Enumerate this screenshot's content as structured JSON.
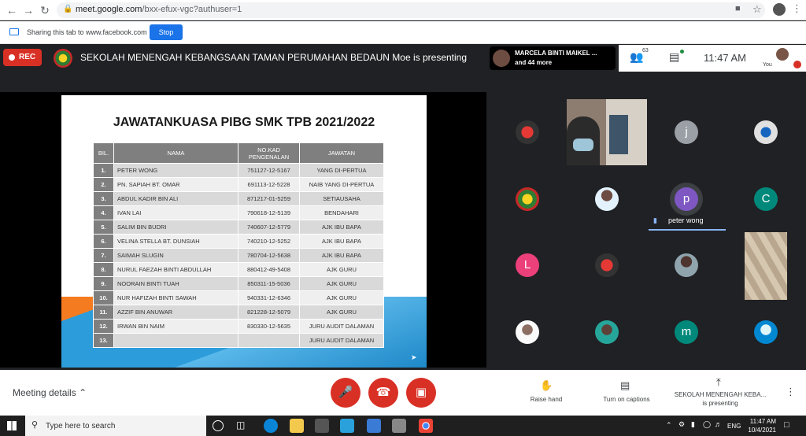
{
  "browser": {
    "url_host": "meet.google.com",
    "url_path": "/bxx-efux-vgc?authuser=1",
    "share_text": "Sharing this tab to www.facebook.com",
    "stop_label": "Stop"
  },
  "topbar": {
    "rec_label": "REC",
    "presenting_text": "SEKOLAH MENENGAH KEBANGSAAN TAMAN PERUMAHAN BEDAUN Moe is presenting",
    "people_name": "MARCELA BINTI MAIKEL ...",
    "people_more": "and 44 more",
    "participant_count": "63",
    "time": "11:47  AM",
    "you_label": "You"
  },
  "slide": {
    "title": "JAWATANKUASA PIBG SMK TPB 2021/2022",
    "headers": [
      "BIL.",
      "NAMA",
      "NO.KAD PENGENALAN",
      "JAWATAN"
    ],
    "rows": [
      {
        "bil": "1.",
        "nama": "PETER WONG",
        "ic": "751127-12-5167",
        "jawatan": "YANG DI-PERTUA"
      },
      {
        "bil": "2.",
        "nama": "PN. SAPIAH BT. OMAR",
        "ic": "691113-12-5228",
        "jawatan": "NAIB YANG DI-PERTUA"
      },
      {
        "bil": "3.",
        "nama": "ABDUL KADIR BIN ALI",
        "ic": "871217-01-5259",
        "jawatan": "SETIAUSAHA"
      },
      {
        "bil": "4.",
        "nama": "IVAN LAI",
        "ic": "790618-12-5139",
        "jawatan": "BENDAHARI"
      },
      {
        "bil": "5.",
        "nama": "SALIM BIN BUDRI",
        "ic": "740607-12-5779",
        "jawatan": "AJK IBU BAPA"
      },
      {
        "bil": "6.",
        "nama": "VELINA STELLA BT. DUNSIAH",
        "ic": "740210-12-5252",
        "jawatan": "AJK IBU BAPA"
      },
      {
        "bil": "7.",
        "nama": "SAIMAH SLUGIN",
        "ic": "780704-12-5638",
        "jawatan": "AJK IBU BAPA"
      },
      {
        "bil": "8.",
        "nama": "NURUL FAEZAH BINTI ABDULLAH",
        "ic": "880412-49-5408",
        "jawatan": "AJK GURU"
      },
      {
        "bil": "9.",
        "nama": "NOORAIN BINTI TUAH",
        "ic": "850311-15-5036",
        "jawatan": "AJK GURU"
      },
      {
        "bil": "10.",
        "nama": "NUR HAFIZAH BINTI SAWAH",
        "ic": "940331-12-6346",
        "jawatan": "AJK GURU"
      },
      {
        "bil": "11.",
        "nama": "AZZIF BIN ANUWAR",
        "ic": "821228-12-5079",
        "jawatan": "AJK GURU"
      },
      {
        "bil": "12.",
        "nama": "IRWAN BIN NAIM",
        "ic": "830330-12-5635",
        "jawatan": "JURU AUDIT DALAMAN"
      },
      {
        "bil": "13.",
        "nama": "",
        "ic": "",
        "jawatan": "JURU AUDIT DALAMAN"
      }
    ]
  },
  "grid": {
    "avatars": [
      {
        "letter": "j",
        "color": "#9aa0a6"
      },
      {
        "letter": "p",
        "color": "#7e57c2"
      },
      {
        "letter": "C",
        "color": "#00897b"
      },
      {
        "letter": "L",
        "color": "#ec407a"
      },
      {
        "letter": "m",
        "color": "#00897b"
      }
    ],
    "speaker": "peter wong"
  },
  "bottombar": {
    "meeting_details": "Meeting details",
    "raise_hand": "Raise hand",
    "captions": "Turn on captions",
    "presenter_name": "SEKOLAH MENENGAH KEBA...",
    "presenter_status": "is presenting"
  },
  "taskbar": {
    "search_placeholder": "Type here to search",
    "lang": "ENG",
    "time": "11:47 AM",
    "date": "10/4/2021"
  }
}
